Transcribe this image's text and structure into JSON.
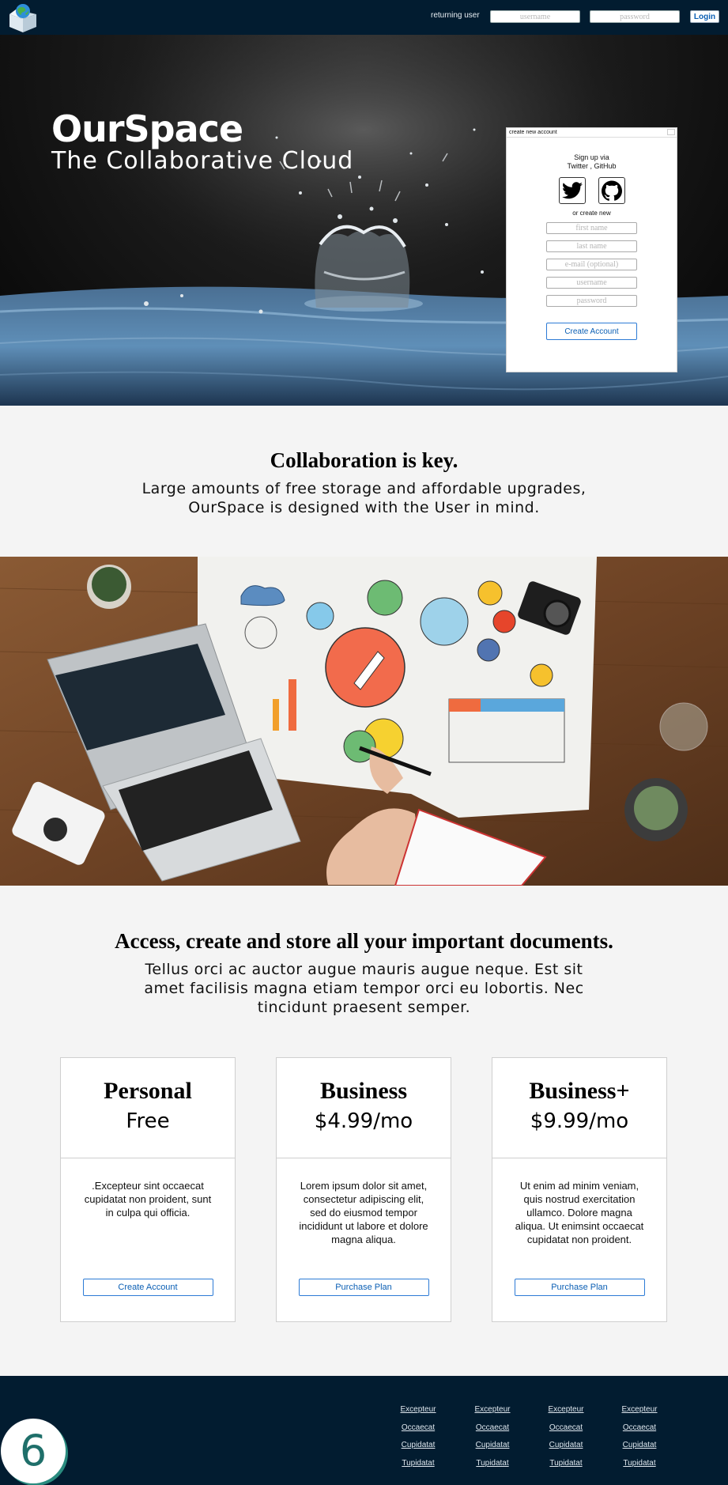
{
  "header": {
    "returning_label": "returning user",
    "username_placeholder": "username",
    "password_placeholder": "password",
    "login_label": "Login"
  },
  "hero": {
    "brand": "OurSpace",
    "tagline": "The Collaborative Cloud"
  },
  "signup": {
    "title": "create new account",
    "via_line1": "Sign up via",
    "via_line2": "Twitter , GitHub",
    "or_text": "or create new",
    "first_name_placeholder": "first name",
    "last_name_placeholder": "last name",
    "email_placeholder": "e-mail (optional)",
    "username_placeholder": "username",
    "password_placeholder": "password",
    "create_label": "Create Account",
    "icons": [
      "twitter-icon",
      "github-icon"
    ]
  },
  "section1": {
    "title": "Collaboration is key.",
    "line1": "Large amounts of free storage and affordable upgrades,",
    "line2": "OurSpace is designed with the User in mind."
  },
  "section2": {
    "title": "Access, create and store all your important documents.",
    "line1": "Tellus orci ac auctor augue mauris augue neque. Est sit",
    "line2": "amet facilisis magna etiam tempor orci eu lobortis. Nec",
    "line3": "tincidunt praesent semper."
  },
  "plans": [
    {
      "name": "Personal",
      "price": "Free",
      "desc": ".Excepteur sint occaecat cupidatat non proident, sunt in culpa qui officia.",
      "button": "Create Account"
    },
    {
      "name": "Business",
      "price": "$4.99/mo",
      "desc": "Lorem ipsum dolor sit amet, consectetur adipiscing elit, sed do eiusmod tempor incididunt ut labore et dolore magna aliqua.",
      "button": "Purchase Plan"
    },
    {
      "name": "Business+",
      "price": "$9.99/mo",
      "desc": "Ut enim ad minim veniam, quis nostrud exercitation ullamco. Dolore magna aliqua. Ut enimsint occaecat cupidatat non proident.",
      "button": "Purchase Plan"
    }
  ],
  "footer": {
    "columns": [
      [
        "Excepteur",
        "Occaecat",
        "Cupidatat",
        "Tupidatat"
      ],
      [
        "Excepteur",
        "Occaecat",
        "Cupidatat",
        "Tupidatat"
      ],
      [
        "Excepteur",
        "Occaecat",
        "Cupidatat",
        "Tupidatat"
      ],
      [
        "Excepteur",
        "Occaecat",
        "Cupidatat",
        "Tupidatat"
      ]
    ],
    "badge": "6"
  },
  "colors": {
    "navy": "#021c30",
    "button_blue": "#0b5fb4",
    "page_bg": "#f4f4f4",
    "badge_teal": "#1f6f6a"
  }
}
